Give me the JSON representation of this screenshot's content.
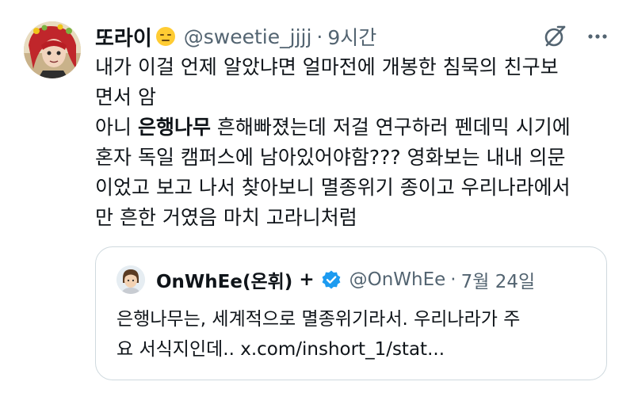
{
  "author": {
    "display_name": "또라이",
    "handle": "@sweetie_jjjj",
    "separator": "·",
    "time": "9시간"
  },
  "tweet": {
    "lines": [
      "내가 이걸 언제 알았냐면 얼마전에 개봉한  침묵의 친구보",
      "면서 암"
    ],
    "line3_pre": "아니 ",
    "line3_bold": "은행나무",
    "line3_post": " 흔해빠졌는데 저걸 연구하러 펜데믹 시기에",
    "lines_after": [
      "혼자 독일 캠퍼스에 남아있어야함??? 영화보는 내내 의문",
      "이었고 보고 나서 찾아보니 멸종위기 종이고 우리나라에서",
      "만 흔한 거였음 마치 고라니처럼"
    ]
  },
  "quote": {
    "display_name": "OnWhEe(온휘)",
    "plus": "+",
    "handle": "@OnWhEe",
    "separator": "·",
    "date": "7월 24일",
    "lines": [
      "은행나무는, 세계적으로 멸종위기라서. 우리나라가 주",
      "요 서식지인데.. x.com/inshort_1/stat..."
    ]
  },
  "icons": {
    "grok": "grok-icon",
    "more": "more-icon",
    "verified": "verified-badge-icon",
    "emoji": "expressionless-face-emoji"
  },
  "colors": {
    "text": "#0f1419",
    "secondary": "#536471",
    "border": "#cfd9de",
    "verified": "#1d9bf0"
  }
}
